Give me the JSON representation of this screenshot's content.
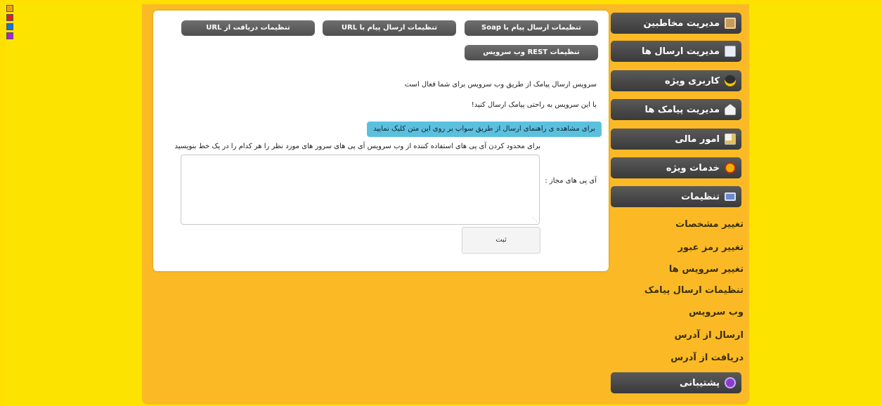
{
  "tabs": {
    "soap": "تنظیمات ارسال پیام با Soap",
    "url_send": "تنظیمات ارسال پیام با URL",
    "url_receive": "تنظیمات دریافت از URL",
    "rest": "تنظیمات REST وب سرویس"
  },
  "content": {
    "service_active": "سرویس ارسال پیامک از طریق وب سرویس برای شما فعال است",
    "easy_send": "با این سرویس به راحتی پیامک ارسال کنید!",
    "guide_banner": "برای مشاهده ی راهنمای ارسال از طریق سواپ بر روی این متن کلیک نمایید",
    "restrict_note": "برای محدود کردن آی پی های استفاده کننده از وب سرویس آی پی های سرور های مورد نظر را هر کدام را در یک خط بنویسید",
    "ip_label": "آی پی های مجاز :",
    "ip_value": "",
    "submit_label": "ثبت"
  },
  "menu": {
    "items": [
      {
        "label": "مدیریت مخاطبین",
        "icon": "contacts-icon"
      },
      {
        "label": "مدیریت ارسال ها",
        "icon": "envelope-icon"
      },
      {
        "label": "کاربری ویژه",
        "icon": "vip-user-icon"
      },
      {
        "label": "مدیریت پیامک ها",
        "icon": "sms-icon"
      },
      {
        "label": "امور مالی",
        "icon": "finance-icon"
      },
      {
        "label": "خدمات ویژه",
        "icon": "medal-icon"
      },
      {
        "label": "تنظیمات",
        "icon": "monitor-icon"
      }
    ],
    "sub_items": [
      "تغییر مشخصات",
      "تغییر رمز عبور",
      "تغییر سرویس ها",
      "تنظیمات ارسال پیامک",
      "وب سرویس",
      "ارسال از آدرس",
      "دریافت از آدرس"
    ],
    "support": {
      "label": "پشتیبانی",
      "icon": "support-icon"
    }
  },
  "colors": {
    "background": "#fde400",
    "content_bg": "#fbba25",
    "menu_button": "#4a4a4a",
    "info_banner": "#5bc0de"
  }
}
